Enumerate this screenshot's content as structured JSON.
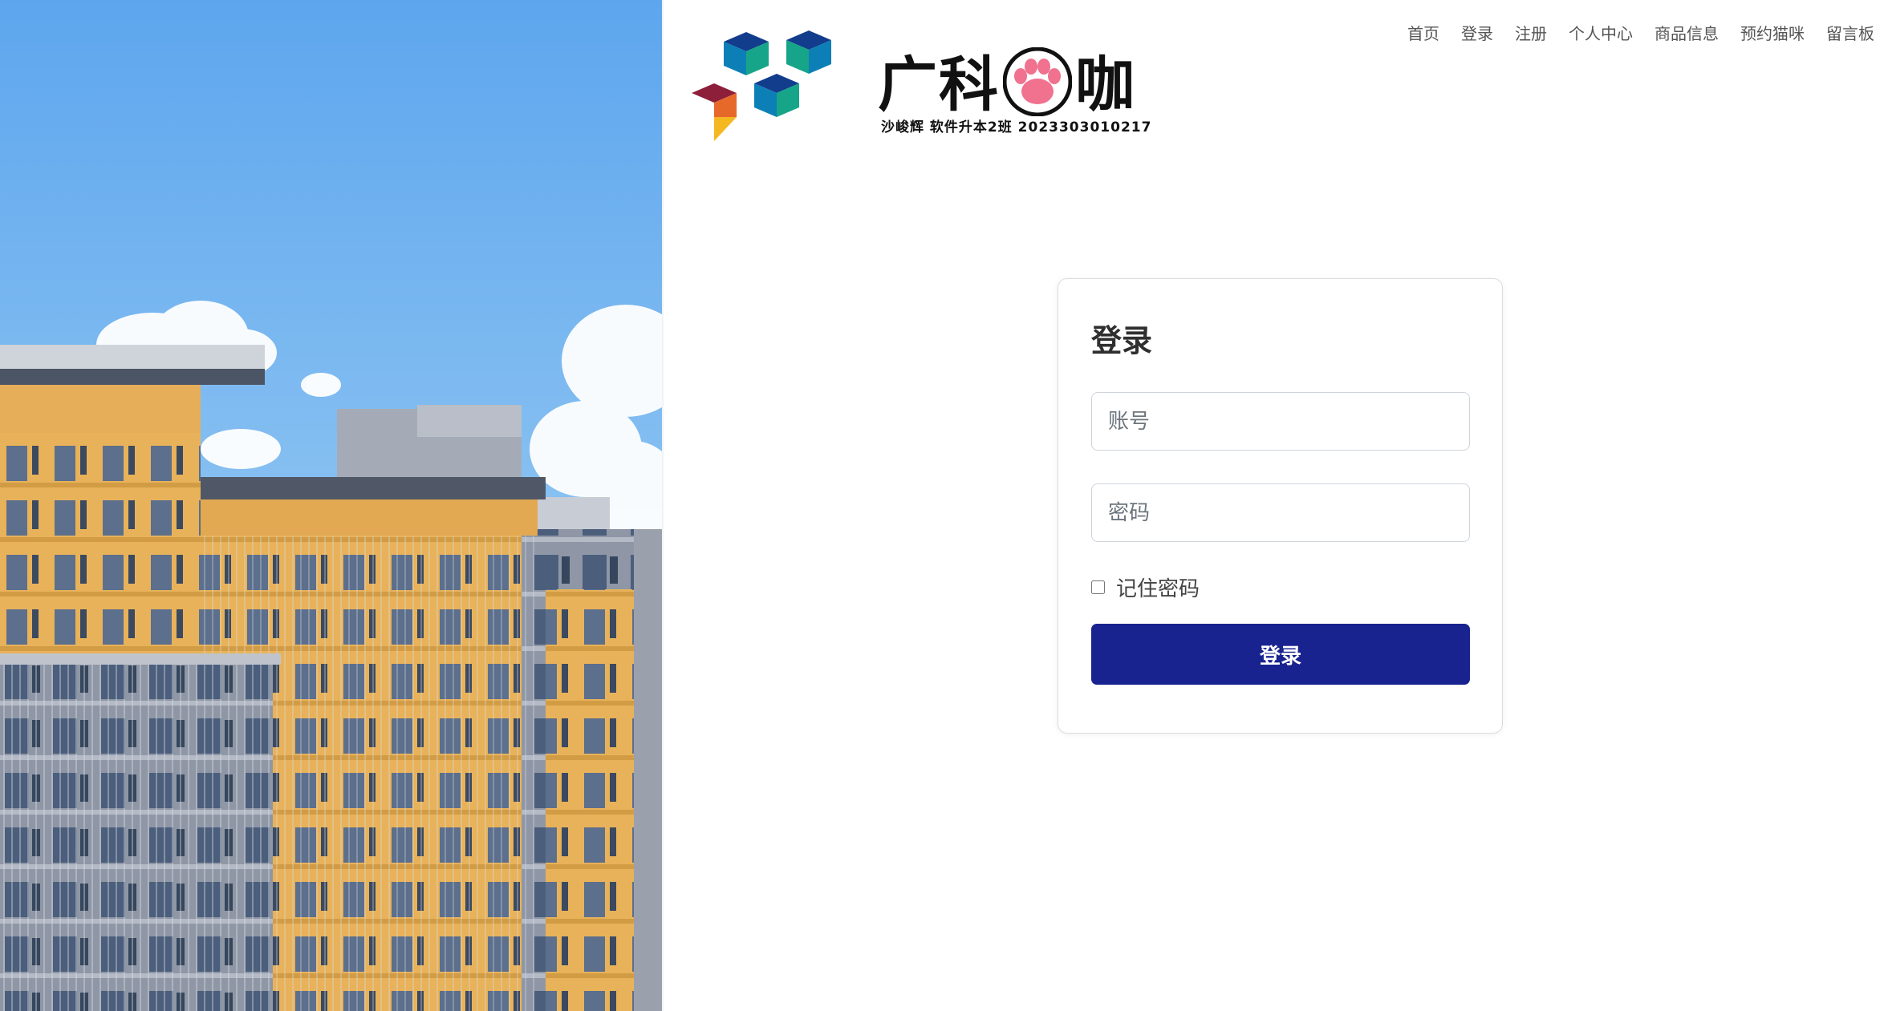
{
  "brand": {
    "title_part1": "广科",
    "title_part2": "咖",
    "subtitle": "沙峻辉 软件升本2班 2023303010217"
  },
  "nav": {
    "items": [
      {
        "label": "首页"
      },
      {
        "label": "登录"
      },
      {
        "label": "注册"
      },
      {
        "label": "个人中心"
      },
      {
        "label": "商品信息"
      },
      {
        "label": "预约猫咪"
      },
      {
        "label": "留言板"
      }
    ]
  },
  "login": {
    "heading": "登录",
    "account_placeholder": "账号",
    "password_placeholder": "密码",
    "remember_label": "记住密码",
    "submit_label": "登录"
  },
  "colors": {
    "primary_button": "#19238f",
    "sky": "#6fb0ec",
    "building_yellow": "#e8b25a"
  }
}
